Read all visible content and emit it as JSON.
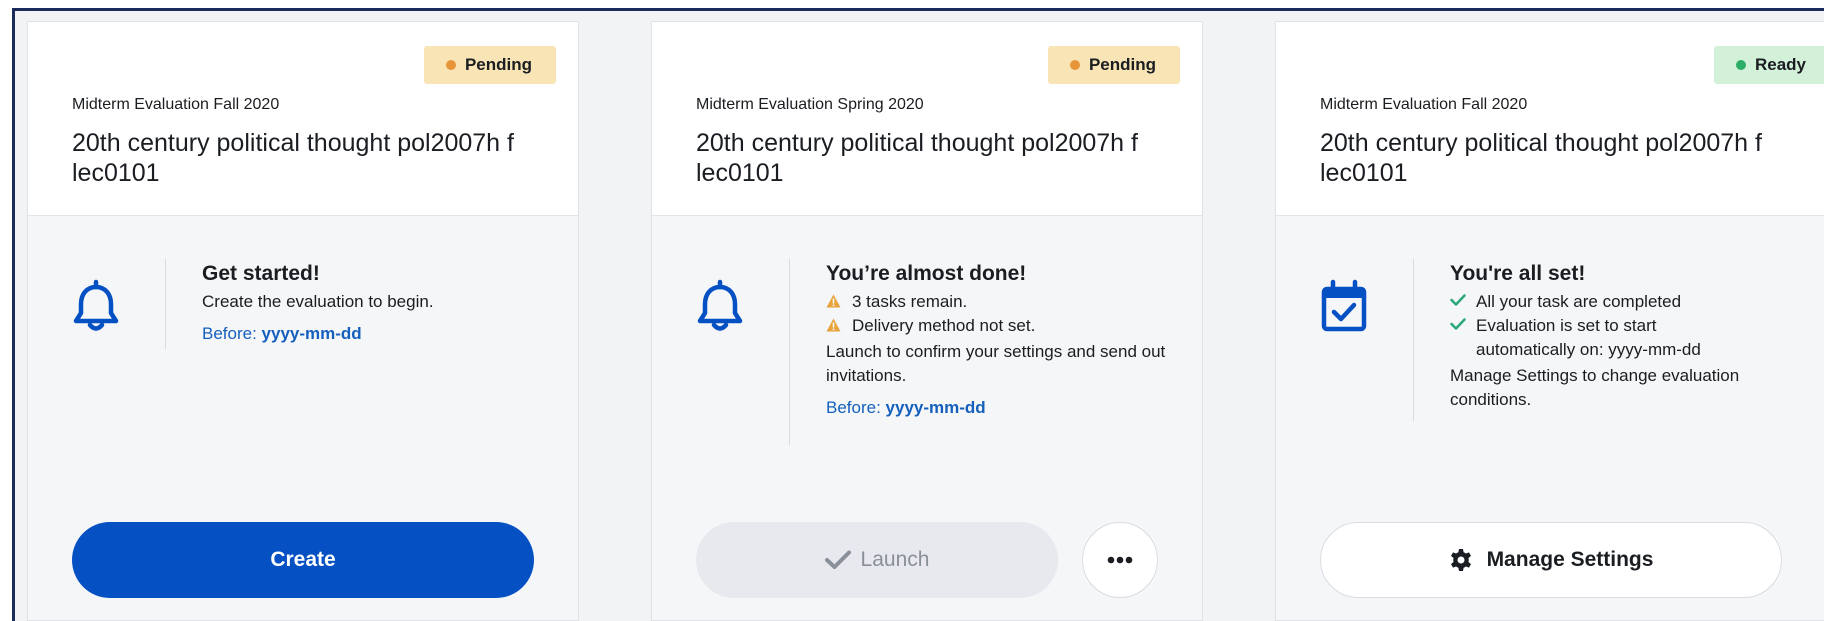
{
  "cards": [
    {
      "status": {
        "label": "Pending",
        "bg": "#f8e4b4",
        "dot": "#e8953a"
      },
      "eyebrow": "Midterm Evaluation Fall 2020",
      "title": "20th century political thought pol2007h f lec0101",
      "icon": "bell-icon",
      "heading": "Get started!",
      "description": "Create the evaluation to begin.",
      "before_label": "Before:",
      "before_value": "yyyy-mm-dd",
      "primary_button": "Create"
    },
    {
      "status": {
        "label": "Pending",
        "bg": "#f8e4b4",
        "dot": "#e8953a"
      },
      "eyebrow": "Midterm Evaluation Spring 2020",
      "title": "20th century political thought pol2007h f lec0101",
      "icon": "bell-icon",
      "heading": "You’re almost done!",
      "warnings": [
        "3 tasks remain.",
        "Delivery method not set."
      ],
      "description": "Launch to confirm your settings and send out invitations.",
      "before_label": "Before:",
      "before_value": "yyyy-mm-dd",
      "primary_button": "Launch",
      "more_button": "more-options"
    },
    {
      "status": {
        "label": "Ready",
        "bg": "#d3f0d9",
        "dot": "#2dae66"
      },
      "eyebrow": "Midterm Evaluation Fall 2020",
      "title": "20th century political thought pol2007h f lec0101",
      "icon": "calendar-check-icon",
      "heading": "You're all set!",
      "checks": [
        "All your task are completed",
        "Evaluation is set to start automatically on: yyyy-mm-dd"
      ],
      "description": "Manage Settings to change evaluation conditions.",
      "primary_button": "Manage Settings"
    }
  ],
  "colors": {
    "primary": "#0550c3",
    "link": "#1560bd",
    "warning": "#e8a33a",
    "success": "#2aa87a",
    "disabled_bg": "#e7e9ee",
    "disabled_text": "#8a9099"
  }
}
